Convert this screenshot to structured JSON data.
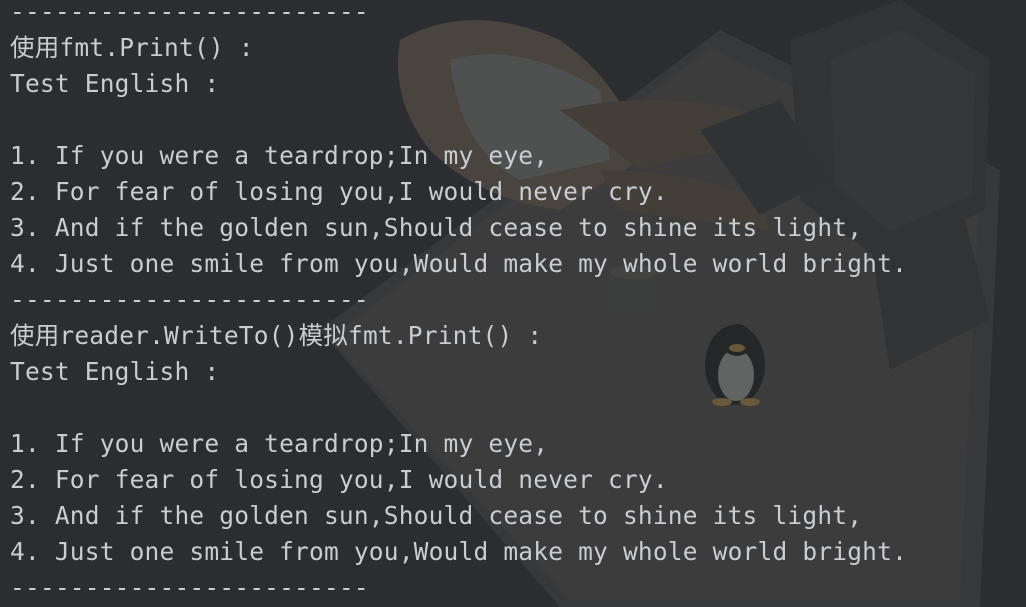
{
  "console": {
    "lines": [
      "------------------------",
      "使用fmt.Print() :",
      "Test English :",
      "",
      "1. If you were a teardrop;In my eye,",
      "2. For fear of losing you,I would never cry.",
      "3. And if the golden sun,Should cease to shine its light,",
      "4. Just one smile from you,Would make my whole world bright.",
      "------------------------",
      "使用reader.WriteTo()模拟fmt.Print() :",
      "Test English :",
      "",
      "1. If you were a teardrop;In my eye,",
      "2. For fear of losing you,I would never cry.",
      "3. And if the golden sun,Should cease to shine its light,",
      "4. Just one smile from you,Would make my whole world bright.",
      "------------------------"
    ]
  },
  "colors": {
    "background": "#2b2d30",
    "text": "#c9ccd1"
  },
  "background_image": "wallpaper-illustration-person-at-computer-with-penguin"
}
